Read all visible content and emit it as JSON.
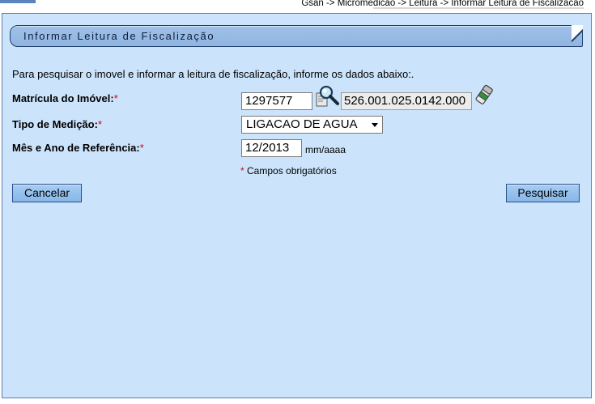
{
  "header": {
    "breadcrumb": "Gsan -> Micromedicao -> Leitura -> Informar Leitura de Fiscalizacao"
  },
  "panel": {
    "title": "Informar Leitura de Fiscalização",
    "instructions": "Para pesquisar o imovel e informar a leitura de fiscalização, informe os dados abaixo:."
  },
  "form": {
    "matricula": {
      "label": "Matrícula do Imóvel:",
      "required_mark": "*",
      "value": "1297577",
      "inscricao": "526.001.025.0142.000",
      "search_icon": "magnifier-icon",
      "clear_icon": "eraser-icon"
    },
    "tipo_medicao": {
      "label": "Tipo de Medição:",
      "required_mark": "*",
      "selected": "LIGACAO DE AGUA"
    },
    "mes_ano": {
      "label": "Mês e Ano de Referência:",
      "required_mark": "*",
      "value": "12/2013",
      "format_hint": "mm/aaaa"
    },
    "required_note_mark": "*",
    "required_note": "Campos obrigatórios"
  },
  "buttons": {
    "cancel": "Cancelar",
    "search": "Pesquisar"
  },
  "colors": {
    "panel_bg": "#cbe3fb",
    "title_bar": "#9fc1e8",
    "button": "#97c2ee",
    "required": "#d4001a"
  }
}
